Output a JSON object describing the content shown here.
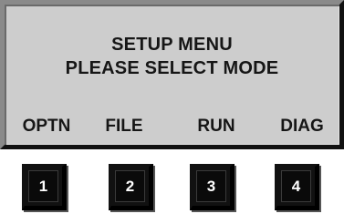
{
  "screen": {
    "title": "SETUP MENU",
    "prompt": "PLEASE SELECT MODE",
    "softkeys": [
      "OPTN",
      "FILE",
      "RUN",
      "DIAG"
    ]
  },
  "keypad": {
    "keys": [
      "1",
      "2",
      "3",
      "4"
    ]
  },
  "colors": {
    "screen_background": "#cdcdcd",
    "screen_text": "#161616",
    "key_background": "#111111",
    "key_text": "#ffffff"
  }
}
